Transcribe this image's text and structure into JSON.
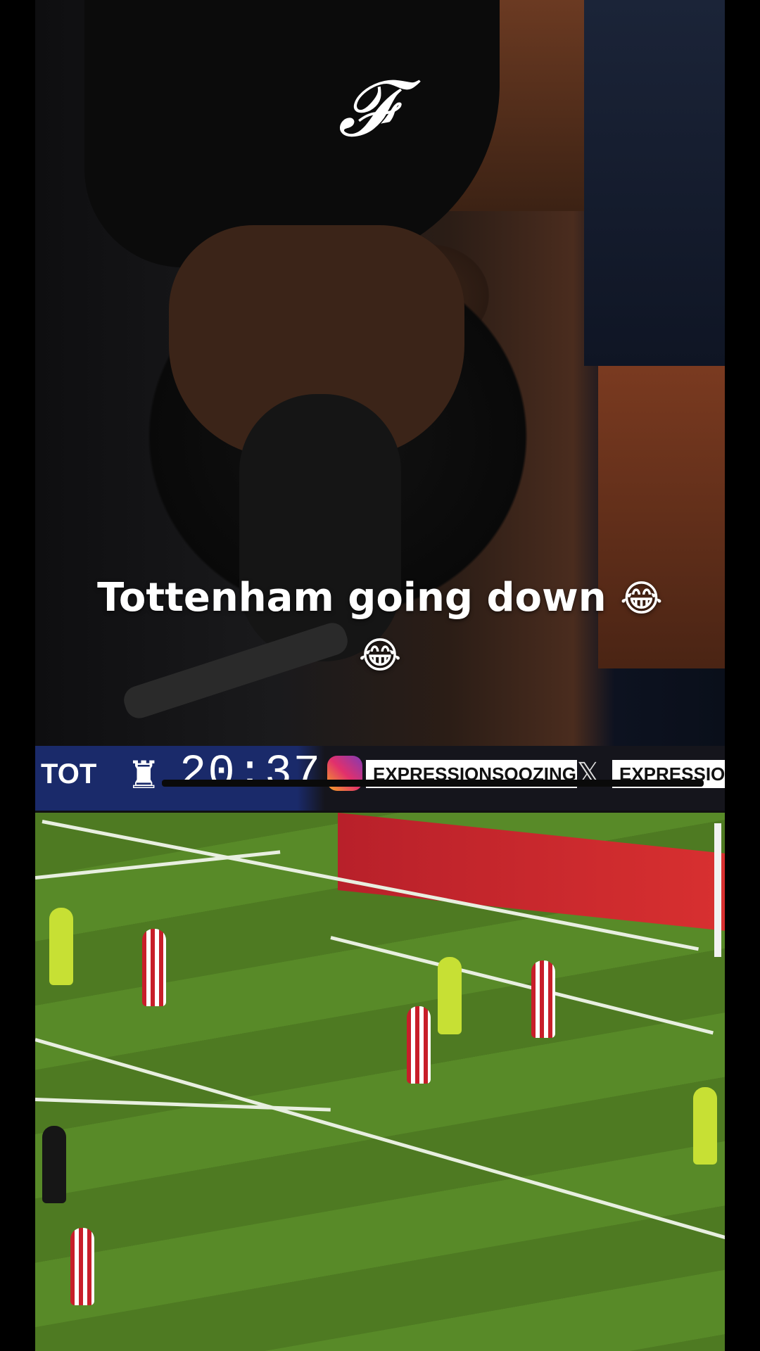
{
  "caption": {
    "line1": "Tottenham going down",
    "emoji": "😂"
  },
  "scoreboard": {
    "team": "TOT",
    "clock": "20:37"
  },
  "social": {
    "instagram_handle": "EXPRESSIONSOOZING",
    "x_handle": "EXPRESSIONSOOZ"
  },
  "icons": {
    "instagram": "instagram-icon",
    "x": "x-logo-icon",
    "crest": "spurs-crest-icon"
  },
  "colors": {
    "scorebug_blue": "#1a2a6a",
    "pitch_green": "#4e7a22",
    "caption_text": "#ffffff"
  }
}
